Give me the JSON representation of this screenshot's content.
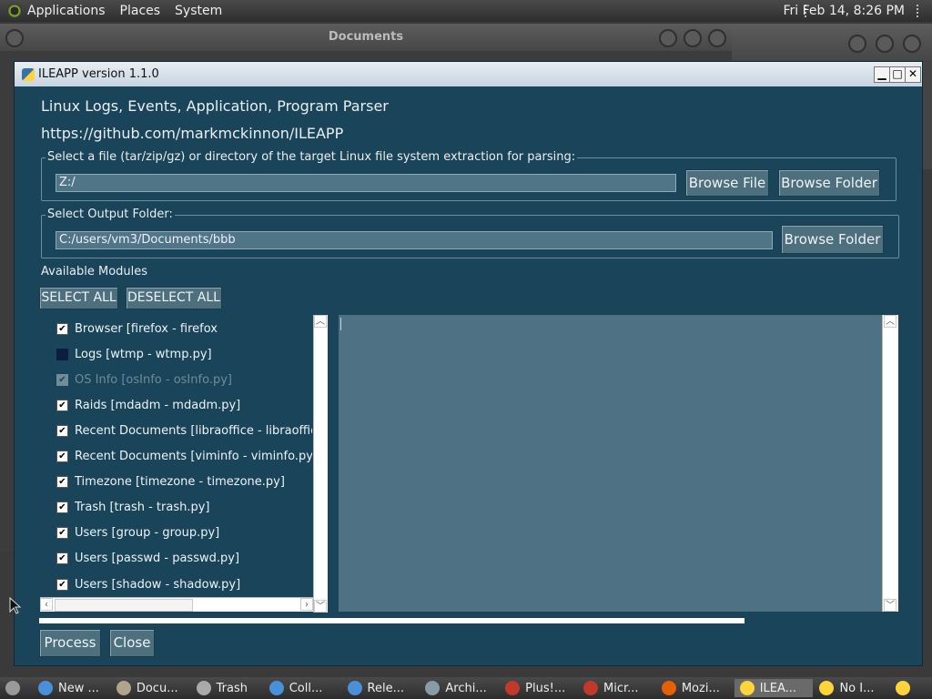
{
  "top_panel": {
    "applications": "Applications",
    "places": "Places",
    "system": "System",
    "clock": "Fri Feb 14,  8:26 PM"
  },
  "background_window": {
    "title": "Documents"
  },
  "window": {
    "title": "ILEAPP version 1.1.0",
    "heading": "Linux Logs, Events, Application, Program Parser",
    "url": "https://github.com/markmckinnon/ILEAPP",
    "input_group": {
      "legend": "Select a file (tar/zip/gz) or directory of the target Linux file system extraction for parsing:",
      "value": "Z:/",
      "browse_file": "Browse File",
      "browse_folder": "Browse Folder"
    },
    "output_group": {
      "legend": "Select Output Folder:",
      "value": "C:/users/vm3/Documents/bbb",
      "browse_folder": "Browse Folder"
    },
    "modules_label": "Available Modules",
    "select_all": "SELECT ALL",
    "deselect_all": "DESELECT ALL",
    "modules": [
      {
        "label": "Browser [firefox - firefox",
        "checked": true,
        "disabled": false
      },
      {
        "label": "Logs [wtmp - wtmp.py]",
        "checked": false,
        "disabled": false
      },
      {
        "label": "OS Info [osInfo - osInfo.py]",
        "checked": true,
        "disabled": true
      },
      {
        "label": "Raids [mdadm - mdadm.py]",
        "checked": true,
        "disabled": false
      },
      {
        "label": "Recent Documents [libraoffice - libraoffice.py",
        "checked": true,
        "disabled": false
      },
      {
        "label": "Recent Documents [viminfo - viminfo.py]",
        "checked": true,
        "disabled": false
      },
      {
        "label": "Timezone [timezone - timezone.py]",
        "checked": true,
        "disabled": false
      },
      {
        "label": "Trash [trash - trash.py]",
        "checked": true,
        "disabled": false
      },
      {
        "label": "Users [group - group.py]",
        "checked": true,
        "disabled": false
      },
      {
        "label": "Users [passwd - passwd.py]",
        "checked": true,
        "disabled": false
      },
      {
        "label": "Users [shadow - shadow.py]",
        "checked": true,
        "disabled": false
      }
    ],
    "progress": 0.0,
    "process": "Process",
    "close": "Close",
    "controls": {
      "minimize": "▁",
      "maximize": "□",
      "close": "✕"
    }
  },
  "taskbar": [
    {
      "label": "",
      "icon": "show-desktop-icon",
      "color": "#9a9a9a"
    },
    {
      "label": "New ...",
      "icon": "chrome-icon",
      "color": "#4a90d9"
    },
    {
      "label": "Docu...",
      "icon": "folder-icon",
      "color": "#b0a48a"
    },
    {
      "label": "Trash",
      "icon": "trash-icon",
      "color": "#aaaaaa"
    },
    {
      "label": "Coll...",
      "icon": "chrome-icon",
      "color": "#4a90d9"
    },
    {
      "label": "Rele...",
      "icon": "chrome-icon",
      "color": "#4a90d9"
    },
    {
      "label": "Archi...",
      "icon": "archive-icon",
      "color": "#8a9aa8"
    },
    {
      "label": "Plus!...",
      "icon": "map-pin-icon",
      "color": "#c0392b"
    },
    {
      "label": "Micr...",
      "icon": "map-pin-icon",
      "color": "#c0392b"
    },
    {
      "label": "Mozi...",
      "icon": "firefox-icon",
      "color": "#e66000"
    },
    {
      "label": "ILEA...",
      "icon": "python-icon",
      "color": "#ffd43b"
    },
    {
      "label": "No I...",
      "icon": "python-icon",
      "color": "#ffd43b"
    },
    {
      "label": "",
      "icon": "python-icon",
      "color": "#ffd43b"
    }
  ]
}
